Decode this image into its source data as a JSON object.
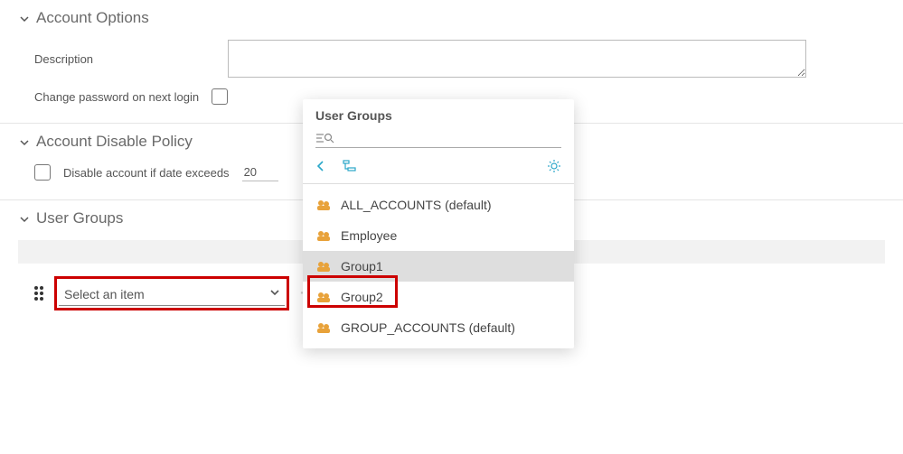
{
  "sections": {
    "account_options": {
      "title": "Account Options",
      "description_label": "Description",
      "description_value": "",
      "change_password_label": "Change password on next login",
      "change_password_checked": false
    },
    "disable_policy": {
      "title": "Account Disable Policy",
      "disable_label": "Disable account if date exceeds",
      "disable_checked": false,
      "date_prefix": "20"
    },
    "user_groups": {
      "title": "User Groups",
      "select_placeholder": "Select an item"
    }
  },
  "popover": {
    "title": "User Groups",
    "items": [
      {
        "label": "ALL_ACCOUNTS (default)",
        "selected": false
      },
      {
        "label": "Employee",
        "selected": false
      },
      {
        "label": "Group1",
        "selected": true
      },
      {
        "label": "Group2",
        "selected": false
      },
      {
        "label": "GROUP_ACCOUNTS (default)",
        "selected": false
      }
    ]
  }
}
